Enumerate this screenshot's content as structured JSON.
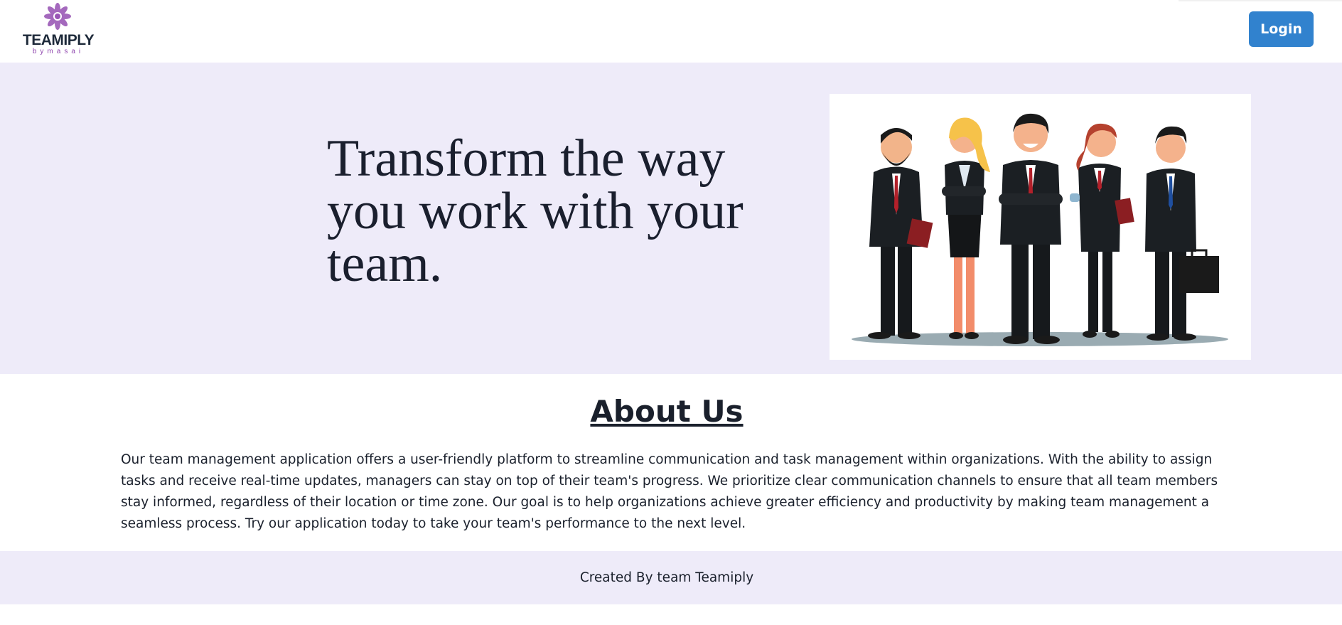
{
  "header": {
    "logo_text": "TEAMIPLY",
    "logo_sub": "bymasai",
    "login_label": "Login"
  },
  "hero": {
    "title": "Transform the way you work with your team.",
    "image_icon": "team-illustration"
  },
  "about": {
    "title": "About Us",
    "text": "Our team management application offers a user-friendly platform to streamline communication and task management within organizations. With the ability to assign tasks and receive real-time updates, managers can stay on top of their team's progress. We prioritize clear communication channels to ensure that all team members stay informed, regardless of their location or time zone. Our goal is to help organizations achieve greater efficiency and productivity by making team management a seamless process. Try our application today to take your team's performance to the next level."
  },
  "footer": {
    "text": "Created By team Teamiply"
  },
  "colors": {
    "accent": "#3182ce",
    "hero_bg": "#eeebf9",
    "logo_purple": "#8e44ad",
    "logo_dark": "#1e2a3a"
  }
}
